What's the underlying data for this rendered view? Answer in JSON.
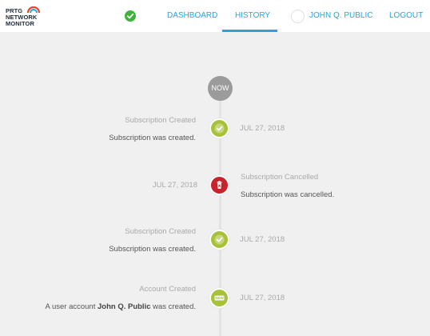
{
  "header": {
    "logo": {
      "line1": "PRTG",
      "line2": "NETWORK",
      "line3": "MONITOR"
    },
    "status_icon": "check-circle-icon",
    "nav": {
      "dashboard": "DASHBOARD",
      "history": "HISTORY",
      "user": "JOHN Q. PUBLIC",
      "logout": "LOGOUT"
    },
    "active_tab": "history"
  },
  "timeline": {
    "now_label": "NOW",
    "events": [
      {
        "title": "Subscription Created",
        "message": "Subscription was created.",
        "date": "JUL 27, 2018",
        "icon": "check-icon",
        "color": "#a7c23a"
      },
      {
        "title": "Subscription Cancelled",
        "message": "Subscription was cancelled.",
        "date": "JUL 27, 2018",
        "icon": "trash-cancel-icon",
        "color": "#c8232c"
      },
      {
        "title": "Subscription Created",
        "message": "Subscription was created.",
        "date": "JUL 27, 2018",
        "icon": "check-icon",
        "color": "#a7c23a"
      },
      {
        "title": "Account Created",
        "message_prefix": "A user account ",
        "message_user": "John Q. Public",
        "message_suffix": " was created.",
        "date": "JUL 27, 2018",
        "icon": "new-badge-icon",
        "icon_text": "NEW",
        "color": "#a7c23a"
      }
    ]
  },
  "colors": {
    "accent": "#2aa4d6",
    "success": "#3db33d",
    "event_green": "#a7c23a",
    "event_red": "#c8232c"
  }
}
